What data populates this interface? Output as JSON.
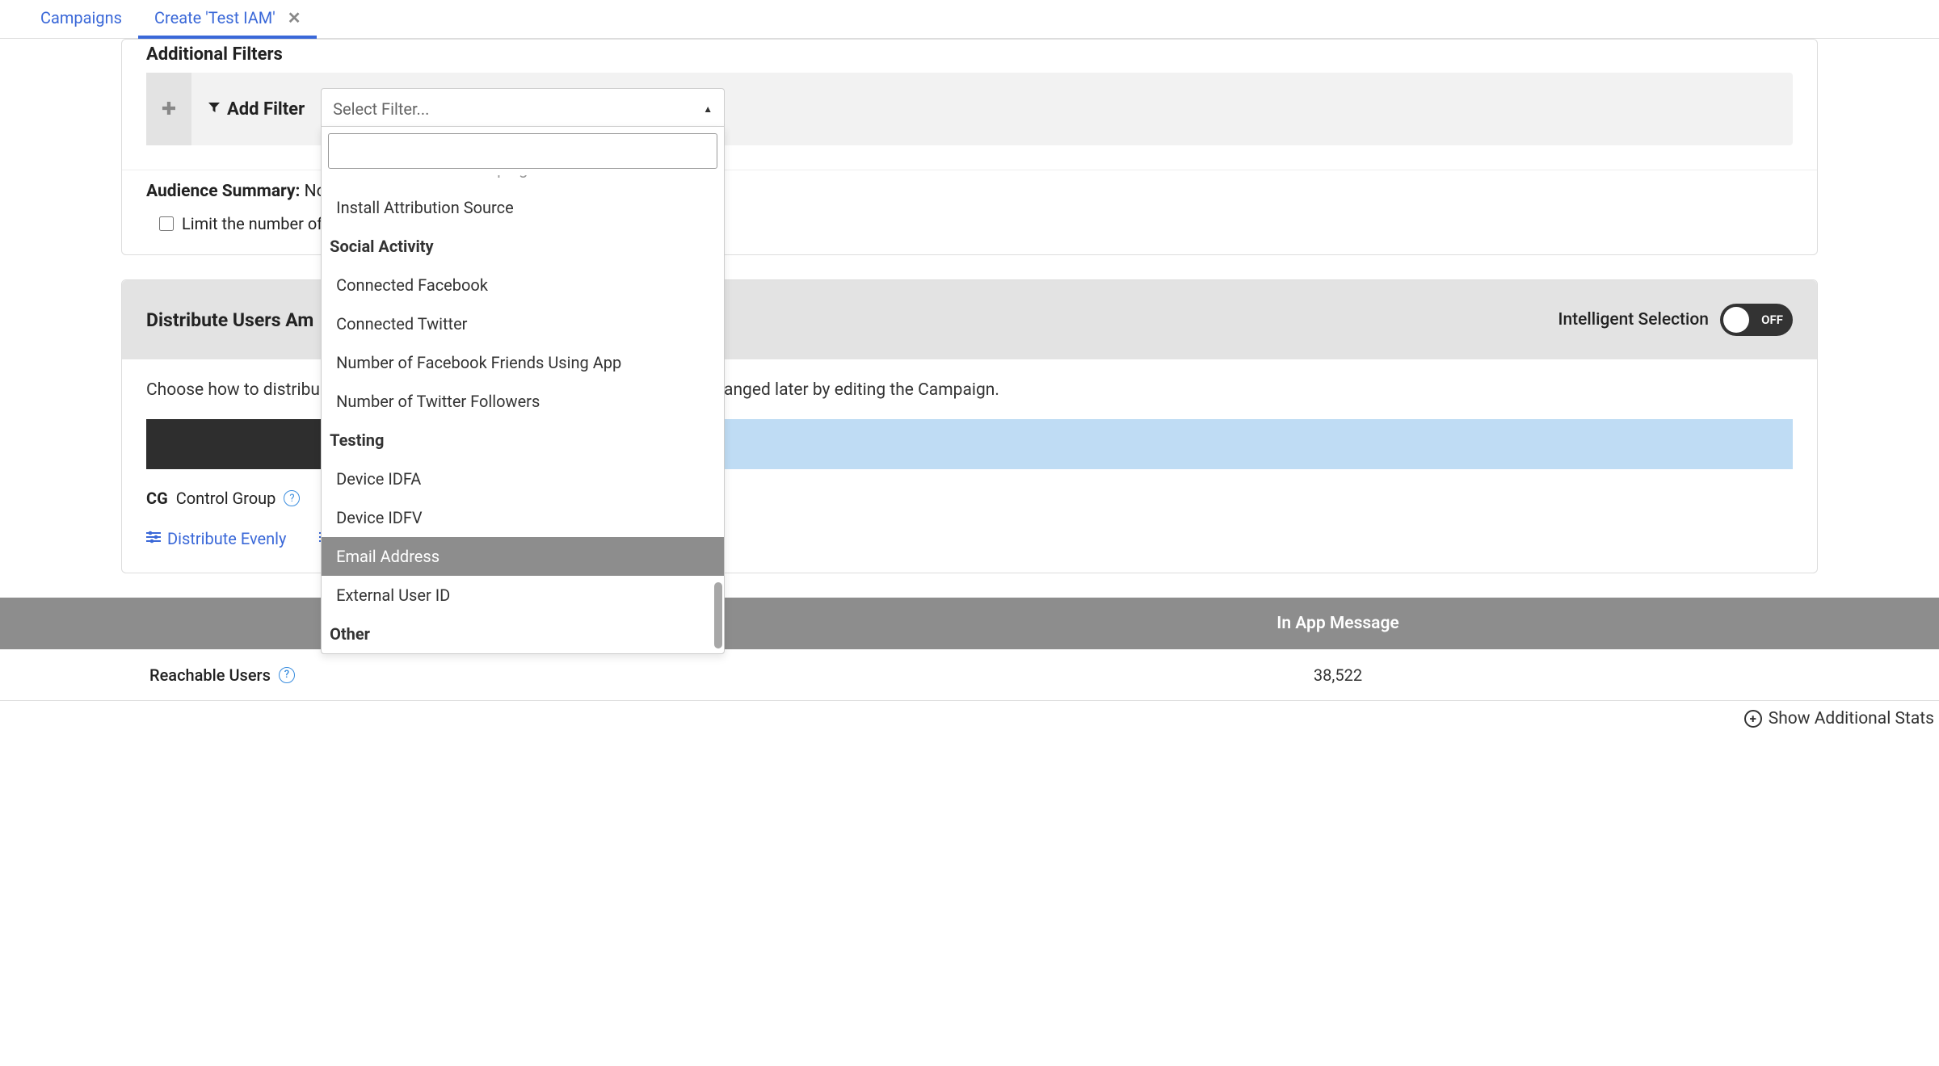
{
  "tabs": {
    "campaigns": "Campaigns",
    "create": "Create 'Test IAM'"
  },
  "filters": {
    "section_title": "Additional Filters",
    "add_filter_label": "Add Filter",
    "select_placeholder": "Select Filter..."
  },
  "dropdown": {
    "cut_item": "Install Attribution Campaign",
    "item_install_source": "Install Attribution Source",
    "group_social": "Social Activity",
    "item_fb": "Connected Facebook",
    "item_tw": "Connected Twitter",
    "item_fb_friends": "Number of Facebook Friends Using App",
    "item_tw_followers": "Number of Twitter Followers",
    "group_testing": "Testing",
    "item_idfa": "Device IDFA",
    "item_idfv": "Device IDFV",
    "item_email": "Email Address",
    "item_external": "External User ID",
    "group_other": "Other"
  },
  "summary": {
    "label": "Audience Summary:",
    "text": "No ",
    "limit_label": "Limit the number of"
  },
  "distribute": {
    "title": "Distribute Users Am",
    "intelligent_label": "Intelligent Selection",
    "toggle_state": "OFF",
    "body_prefix": "Choose how to distribu",
    "body_suffix": "anged later by editing the Campaign.",
    "cg_badge": "CG",
    "cg_label": "Control Group",
    "evenly_label": "Distribute Evenly"
  },
  "stats": {
    "col_message": "In App Message",
    "row_reachable_label": "Reachable Users",
    "row_reachable_value": "38,522",
    "footer_label": "Show Additional Stats"
  }
}
